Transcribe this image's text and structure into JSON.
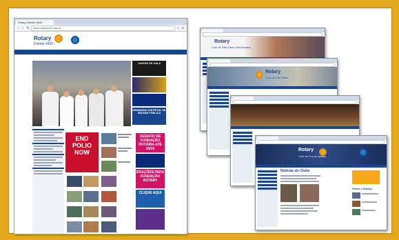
{
  "main_window": {
    "tab_title": "Rotary Distrito 4420",
    "url": "www.rotary4420.org.br",
    "brand": "Rotary",
    "district": "Distrito 4420",
    "partner_line": "",
    "header_right": "",
    "nav": [
      "",
      ""
    ],
    "hero_caption": "",
    "side_tiles": [
      {
        "text": "JANTAR DE GALA",
        "color": "#1a1a1a"
      },
      {
        "text": "",
        "color": "#2b2b6b"
      },
      {
        "text": "",
        "color": "#0a2a7a"
      },
      {
        "text": "SEMINÁRIO DISTRITAL DE IMAGEM PÚBLICA",
        "color": "#17458f"
      }
    ],
    "left_heads": [
      "",
      "",
      "",
      ""
    ],
    "polio_lines": [
      "END",
      "POLIO",
      "NOW"
    ],
    "right_tiles": [
      {
        "text": "DESAFIO DE FUNDAÇÃO ROTÁRIA ATÉ 24/10",
        "color": "#d41367"
      },
      {
        "text": "",
        "color": "#0a2a7a"
      },
      {
        "text": "DOAÇÕES PARA FUNDAÇÃO ROTARY",
        "color": "#d41367"
      },
      {
        "text": "CLIQUE AQUI",
        "color": "#1f5fb0"
      },
      {
        "text": "",
        "color": "#5b2d8c"
      }
    ]
  },
  "stacked_windows": [
    {
      "brand": "Rotary",
      "club": "Club de São Paulo Vila Mariana",
      "color": "#8a5a3b"
    },
    {
      "brand": "Rotary",
      "club": "Club de São Paulo",
      "color": "#6a7f92"
    },
    {
      "brand": "",
      "club": "",
      "color": "#4a2f20"
    },
    {
      "brand": "Rotary",
      "club": "Club de Foz do Iguaçu",
      "color": "#1a2f5a"
    }
  ],
  "last_window": {
    "section_title": "Notícias do Clube",
    "side_title": "Sobre o Rotary"
  }
}
